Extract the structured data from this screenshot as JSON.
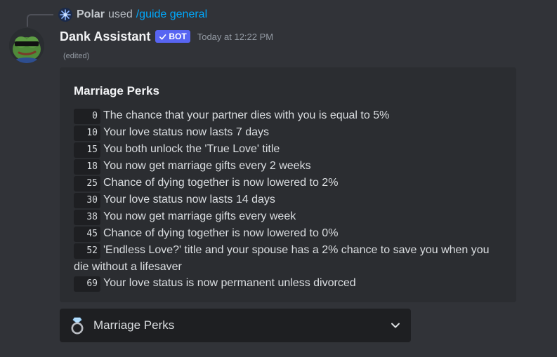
{
  "reply": {
    "user": "Polar",
    "action": "used",
    "command": "/guide general"
  },
  "message": {
    "author": "Dank Assistant",
    "badge": "BOT",
    "timestamp": "Today at 12:22 PM",
    "edited": "(edited)"
  },
  "embed": {
    "title": "Marriage Perks",
    "perks": [
      {
        "level": "0",
        "text": "The chance that your partner dies with you is equal to 5%"
      },
      {
        "level": "10",
        "text": "Your love status now lasts 7 days"
      },
      {
        "level": "15",
        "text": "You both unlock the 'True Love' title"
      },
      {
        "level": "18",
        "text": "You now get marriage gifts every 2 weeks"
      },
      {
        "level": "25",
        "text": "Chance of dying together is now lowered to 2%"
      },
      {
        "level": "30",
        "text": "Your love status now lasts 14 days"
      },
      {
        "level": "38",
        "text": "You now get marriage gifts every week"
      },
      {
        "level": "45",
        "text": "Chance of dying together is now lowered to 0%"
      },
      {
        "level": "52",
        "text": "'Endless Love?' title and your spouse has a 2% chance to save you when you die without a lifesaver"
      },
      {
        "level": "69",
        "text": "Your love status is now permanent unless divorced"
      }
    ]
  },
  "select_menu": {
    "label": "Marriage Perks",
    "icon": "ring-icon"
  },
  "colors": {
    "background": "#313338",
    "embed_background": "#2b2d31",
    "bot_badge": "#5865f2",
    "command_link": "#00a8fc"
  }
}
